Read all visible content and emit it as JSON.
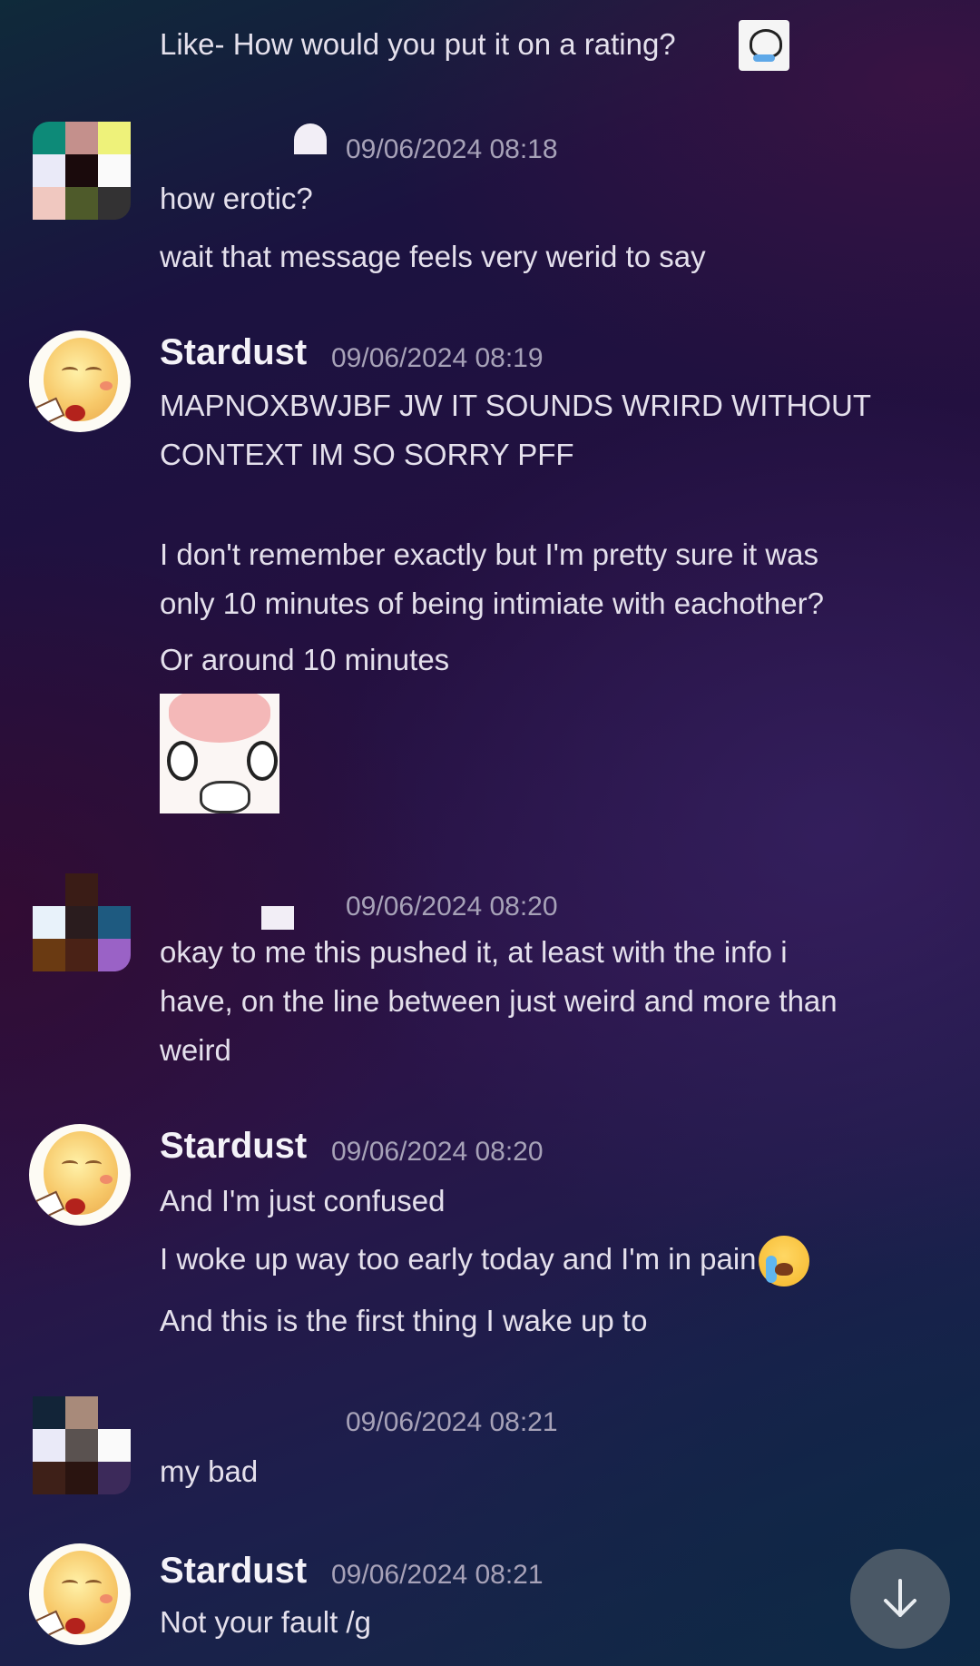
{
  "messages": {
    "m0": {
      "lines": [
        "Like- How would you put it on a rating?"
      ],
      "emoji": "skull-crying-sticker"
    },
    "m1": {
      "timestamp": "09/06/2024 08:18",
      "lines": [
        "how erotic?",
        "wait that message feels very werid to say"
      ]
    },
    "m2": {
      "username": "Stardust",
      "timestamp": "09/06/2024 08:19",
      "lines": [
        "MAPNOXBWJBF JW IT SOUNDS WRIRD WITHOUT",
        "CONTEXT IM SO SORRY PFF",
        "I don't remember exactly but I'm pretty sure it was",
        "only 10 minutes of being intimiate with eachother?",
        "Or around 10 minutes"
      ],
      "image": "anime-girl-reaction-image"
    },
    "m3": {
      "timestamp": "09/06/2024 08:20",
      "lines": [
        "okay to me this pushed it, at least with the info i",
        "have, on the line between just weird and more than",
        "weird"
      ]
    },
    "m4": {
      "username": "Stardust",
      "timestamp": "09/06/2024 08:20",
      "lines": [
        "And I'm just confused",
        "I woke up way too early today and I'm in pain",
        "And this is the first thing I wake up to"
      ],
      "emoji": "loudly-crying-face-emoji"
    },
    "m5": {
      "timestamp": "09/06/2024 08:21",
      "lines": [
        "my bad"
      ]
    },
    "m6": {
      "username": "Stardust",
      "timestamp": "09/06/2024 08:21",
      "lines": [
        "Not your fault /g"
      ]
    }
  },
  "scroll_button": {
    "icon": "arrow-down-icon"
  },
  "colors": {
    "username": "#f4f2f8",
    "text": "#e4e0ec",
    "timestamp": "#a7a2b8",
    "scroll_button": "#4a5866"
  }
}
